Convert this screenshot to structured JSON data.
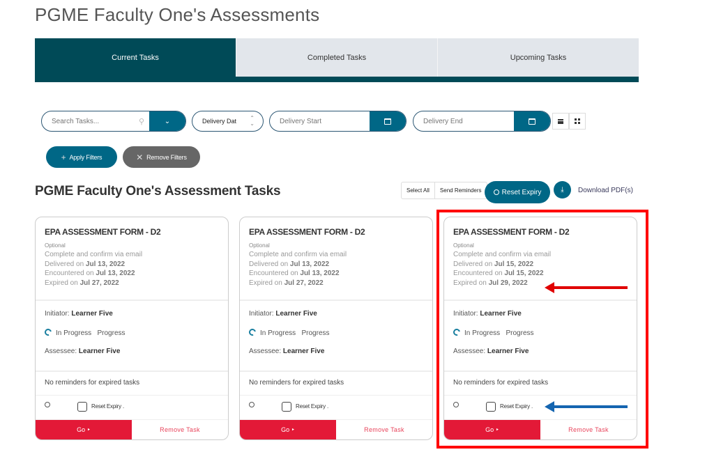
{
  "page": {
    "title": "PGME Faculty One's Assessments"
  },
  "tabs": [
    {
      "label": "Current Tasks",
      "active": true
    },
    {
      "label": "Completed Tasks",
      "active": false
    },
    {
      "label": "Upcoming Tasks",
      "active": false
    }
  ],
  "filters": {
    "search_placeholder": "Search Tasks...",
    "search_value": "",
    "sort_selected": "Delivery Date",
    "sort_display": "Delivery Dat",
    "delivery_start_placeholder": "Delivery Start",
    "delivery_end_placeholder": "Delivery End",
    "apply_label": "Apply Filters",
    "remove_label": "Remove Filters"
  },
  "section": {
    "title": "PGME Faculty One's Assessment Tasks",
    "select_all_label": "Select All",
    "send_reminders_label": "Send Reminders",
    "reset_expiry_label": "Reset Expiry",
    "download_label": "Download PDF(s)"
  },
  "cards": [
    {
      "title": "EPA ASSESSMENT FORM - D2",
      "optional": "Optional",
      "method": "Complete and confirm via email",
      "delivered_prefix": "Delivered on ",
      "delivered": "Jul 13, 2022",
      "encountered_prefix": "Encountered on ",
      "encountered": "Jul 13, 2022",
      "expired_prefix": "Expired on ",
      "expired": "Jul 27, 2022",
      "initiator_label": "Initiator: ",
      "initiator": "Learner Five",
      "status": "In Progress",
      "status_extra": "Progress",
      "assessee_label": "Assessee: ",
      "assessee": "Learner Five",
      "reminder_note": "No reminders for expired tasks",
      "reset_expiry_label": "Reset Expiry .",
      "reset_expiry_checked": false,
      "go_label": "Go ‣",
      "remove_label": "Remove Task"
    },
    {
      "title": "EPA ASSESSMENT FORM - D2",
      "optional": "Optional",
      "method": "Complete and confirm via email",
      "delivered_prefix": "Delivered on ",
      "delivered": "Jul 13, 2022",
      "encountered_prefix": "Encountered on ",
      "encountered": "Jul 13, 2022",
      "expired_prefix": "Expired on ",
      "expired": "Jul 27, 2022",
      "initiator_label": "Initiator: ",
      "initiator": "Learner Five",
      "status": "In Progress",
      "status_extra": "Progress",
      "assessee_label": "Assessee: ",
      "assessee": "Learner Five",
      "reminder_note": "No reminders for expired tasks",
      "reset_expiry_label": "Reset Expiry .",
      "reset_expiry_checked": false,
      "go_label": "Go ‣",
      "remove_label": "Remove Task"
    },
    {
      "title": "EPA ASSESSMENT FORM - D2",
      "optional": "Optional",
      "method": "Complete and confirm via email",
      "delivered_prefix": "Delivered on ",
      "delivered": "Jul 15, 2022",
      "encountered_prefix": "Encountered on ",
      "encountered": "Jul 15, 2022",
      "expired_prefix": "Expired on ",
      "expired": "Jul 29, 2022",
      "initiator_label": "Initiator: ",
      "initiator": "Learner Five",
      "status": "In Progress",
      "status_extra": "Progress",
      "assessee_label": "Assessee: ",
      "assessee": "Learner Five",
      "reminder_note": "No reminders for expired tasks",
      "reset_expiry_label": "Reset Expiry .",
      "reset_expiry_checked": false,
      "go_label": "Go ‣",
      "remove_label": "Remove Task"
    }
  ],
  "annotations": {
    "highlight_color": "#ff0000",
    "arrow_expired_color": "#e00000",
    "arrow_reset_color": "#1565b0"
  },
  "colors": {
    "tab_active": "#004a57",
    "primary": "#006786",
    "danger": "#e31937"
  }
}
